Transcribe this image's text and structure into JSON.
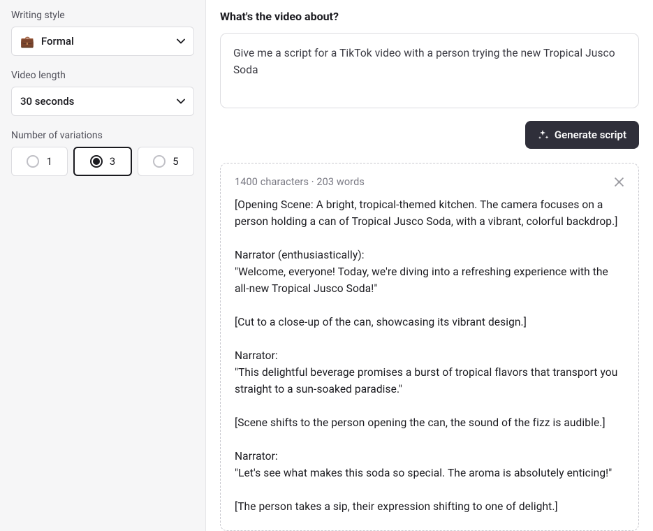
{
  "sidebar": {
    "writing_style": {
      "label": "Writing style",
      "icon": "💼",
      "value": "Formal"
    },
    "video_length": {
      "label": "Video length",
      "value": "30 seconds"
    },
    "variations": {
      "label": "Number of variations",
      "options": [
        "1",
        "3",
        "5"
      ],
      "selected_index": 1
    }
  },
  "main": {
    "heading": "What's the video about?",
    "prompt_value": "Give me a script for a TikTok video with a person trying the new Tropical Jusco Soda",
    "generate_label": "Generate script",
    "result": {
      "meta": "1400 characters · 203 words",
      "body": "[Opening Scene: A bright, tropical-themed kitchen. The camera focuses on a person holding a can of Tropical Jusco Soda, with a vibrant, colorful backdrop.]\n\nNarrator (enthusiastically):\n\"Welcome, everyone! Today, we're diving into a refreshing experience with the all-new Tropical Jusco Soda!\"\n\n[Cut to a close-up of the can, showcasing its vibrant design.]\n\nNarrator:\n\"This delightful beverage promises a burst of tropical flavors that transport you straight to a sun-soaked paradise.\"\n\n[Scene shifts to the person opening the can, the sound of the fizz is audible.]\n\nNarrator:\n\"Let's see what makes this soda so special. The aroma is absolutely enticing!\"\n\n[The person takes a sip, their expression shifting to one of delight.]"
    }
  }
}
